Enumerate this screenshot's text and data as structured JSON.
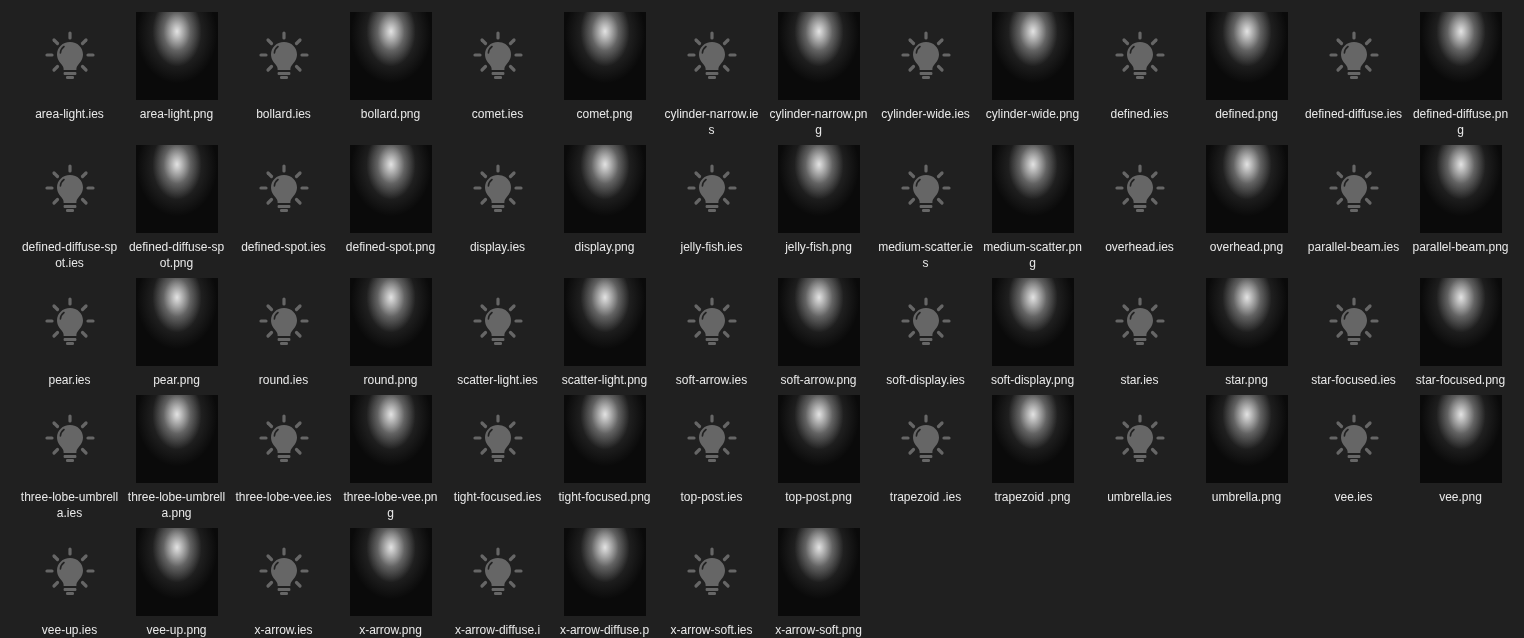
{
  "files": [
    {
      "name": "area-light.ies",
      "kind": "ies"
    },
    {
      "name": "area-light.png",
      "kind": "png"
    },
    {
      "name": "bollard.ies",
      "kind": "ies"
    },
    {
      "name": "bollard.png",
      "kind": "png"
    },
    {
      "name": "comet.ies",
      "kind": "ies"
    },
    {
      "name": "comet.png",
      "kind": "png"
    },
    {
      "name": "cylinder-narrow.ies",
      "kind": "ies"
    },
    {
      "name": "cylinder-narrow.png",
      "kind": "png"
    },
    {
      "name": "cylinder-wide.ies",
      "kind": "ies"
    },
    {
      "name": "cylinder-wide.png",
      "kind": "png"
    },
    {
      "name": "defined.ies",
      "kind": "ies"
    },
    {
      "name": "defined.png",
      "kind": "png"
    },
    {
      "name": "defined-diffuse.ies",
      "kind": "ies"
    },
    {
      "name": "defined-diffuse.png",
      "kind": "png"
    },
    {
      "name": "defined-diffuse-spot.ies",
      "kind": "ies"
    },
    {
      "name": "defined-diffuse-spot.png",
      "kind": "png"
    },
    {
      "name": "defined-spot.ies",
      "kind": "ies"
    },
    {
      "name": "defined-spot.png",
      "kind": "png"
    },
    {
      "name": "display.ies",
      "kind": "ies"
    },
    {
      "name": "display.png",
      "kind": "png"
    },
    {
      "name": "jelly-fish.ies",
      "kind": "ies"
    },
    {
      "name": "jelly-fish.png",
      "kind": "png"
    },
    {
      "name": "medium-scatter.ies",
      "kind": "ies"
    },
    {
      "name": "medium-scatter.png",
      "kind": "png"
    },
    {
      "name": "overhead.ies",
      "kind": "ies"
    },
    {
      "name": "overhead.png",
      "kind": "png"
    },
    {
      "name": "parallel-beam.ies",
      "kind": "ies"
    },
    {
      "name": "parallel-beam.png",
      "kind": "png"
    },
    {
      "name": "pear.ies",
      "kind": "ies"
    },
    {
      "name": "pear.png",
      "kind": "png"
    },
    {
      "name": "round.ies",
      "kind": "ies"
    },
    {
      "name": "round.png",
      "kind": "png"
    },
    {
      "name": "scatter-light.ies",
      "kind": "ies"
    },
    {
      "name": "scatter-light.png",
      "kind": "png"
    },
    {
      "name": "soft-arrow.ies",
      "kind": "ies"
    },
    {
      "name": "soft-arrow.png",
      "kind": "png"
    },
    {
      "name": "soft-display.ies",
      "kind": "ies"
    },
    {
      "name": "soft-display.png",
      "kind": "png"
    },
    {
      "name": "star.ies",
      "kind": "ies"
    },
    {
      "name": "star.png",
      "kind": "png"
    },
    {
      "name": "star-focused.ies",
      "kind": "ies"
    },
    {
      "name": "star-focused.png",
      "kind": "png"
    },
    {
      "name": "three-lobe-umbrella.ies",
      "kind": "ies"
    },
    {
      "name": "three-lobe-umbrella.png",
      "kind": "png"
    },
    {
      "name": "three-lobe-vee.ies",
      "kind": "ies"
    },
    {
      "name": "three-lobe-vee.png",
      "kind": "png"
    },
    {
      "name": "tight-focused.ies",
      "kind": "ies"
    },
    {
      "name": "tight-focused.png",
      "kind": "png"
    },
    {
      "name": "top-post.ies",
      "kind": "ies"
    },
    {
      "name": "top-post.png",
      "kind": "png"
    },
    {
      "name": "trapezoid .ies",
      "kind": "ies"
    },
    {
      "name": "trapezoid .png",
      "kind": "png"
    },
    {
      "name": "umbrella.ies",
      "kind": "ies"
    },
    {
      "name": "umbrella.png",
      "kind": "png"
    },
    {
      "name": "vee.ies",
      "kind": "ies"
    },
    {
      "name": "vee.png",
      "kind": "png"
    },
    {
      "name": "vee-up.ies",
      "kind": "ies"
    },
    {
      "name": "vee-up.png",
      "kind": "png"
    },
    {
      "name": "x-arrow.ies",
      "kind": "ies"
    },
    {
      "name": "x-arrow.png",
      "kind": "png"
    },
    {
      "name": "x-arrow-diffuse.i",
      "kind": "ies"
    },
    {
      "name": "x-arrow-diffuse.p",
      "kind": "png"
    },
    {
      "name": "x-arrow-soft.ies",
      "kind": "ies"
    },
    {
      "name": "x-arrow-soft.png",
      "kind": "png"
    }
  ]
}
